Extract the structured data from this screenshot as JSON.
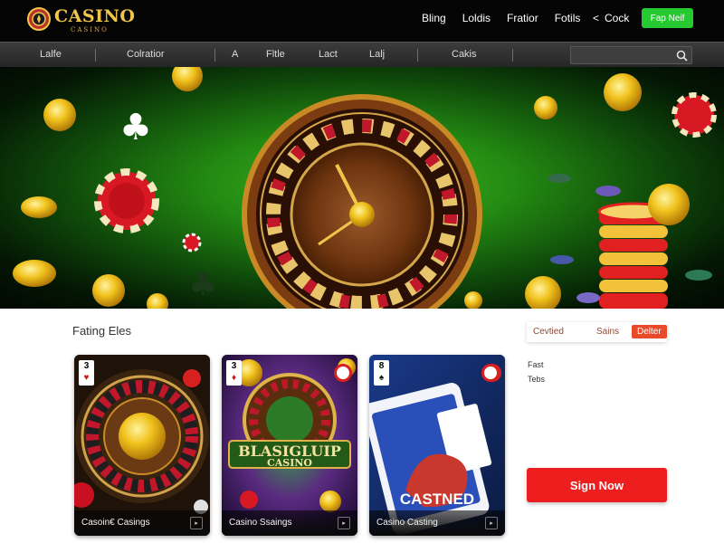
{
  "header": {
    "brand": "CASINO",
    "brand_sub": "CASINO",
    "nav": [
      "Bling",
      "Loldis",
      "Fratior",
      "Fotils"
    ],
    "back_label": "Cock",
    "cta_label": "Fap Neif"
  },
  "subnav": {
    "items": [
      "Lalfe",
      "Colratior",
      "A",
      "Fltle",
      "Lact",
      "Lalj",
      "Cakis"
    ],
    "search_placeholder": ""
  },
  "section": {
    "title": "Fating Eles",
    "tabs": [
      "Cevtied",
      "Sains",
      "Delter"
    ],
    "active_tab": 2,
    "side_lines": [
      "Fast",
      "Tebs"
    ],
    "signup_label": "Sign Now"
  },
  "cards": [
    {
      "label": "Casoin€ Casings",
      "rank": "3",
      "suit": "♥",
      "suit_color": "#d01818"
    },
    {
      "label": "Casino Ssaings",
      "rank": "3",
      "suit": "♦",
      "suit_color": "#d01818",
      "overlay_top": "BLASIGLUIP",
      "overlay_bottom": "CASINO"
    },
    {
      "label": "Casino Casting",
      "rank": "8",
      "suit": "♠",
      "suit_color": "#111111",
      "overlay_bottom": "CASTNED"
    }
  ],
  "colors": {
    "accent_green": "#26c92f",
    "accent_red": "#ee1e1e",
    "tab_active": "#e84a2a",
    "gold": "#f0c64a"
  },
  "icons": {
    "logo": "casino-chip-icon",
    "back": "chevron-left-icon",
    "search": "search-icon"
  }
}
